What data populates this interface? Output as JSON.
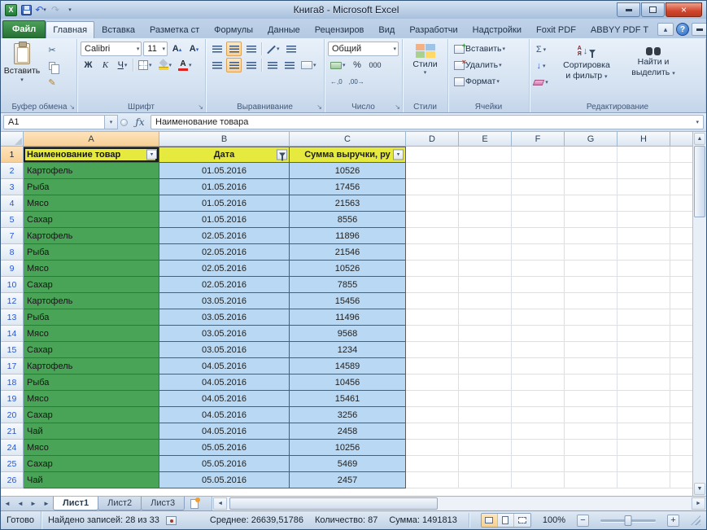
{
  "colors": {
    "header_fill": "#e6e93e",
    "col_a_fill": "#4aa457",
    "data_fill": "#b9d8f3",
    "row_number_filtered": "#2456d6",
    "file_tab_green": "#2f7d3a",
    "selection_highlight": "#f8cf95"
  },
  "title_bar": {
    "title": "Книга8  -  Microsoft Excel"
  },
  "ribbon_tabs": [
    {
      "label": "Файл",
      "file": true
    },
    {
      "label": "Главная",
      "active": true
    },
    {
      "label": "Вставка"
    },
    {
      "label": "Разметка ст"
    },
    {
      "label": "Формулы"
    },
    {
      "label": "Данные"
    },
    {
      "label": "Рецензиров"
    },
    {
      "label": "Вид"
    },
    {
      "label": "Разработчи"
    },
    {
      "label": "Надстройки"
    },
    {
      "label": "Foxit PDF"
    },
    {
      "label": "ABBYY PDF T"
    }
  ],
  "ribbon": {
    "clipboard": {
      "paste_label": "Вставить",
      "group_label": "Буфер обмена"
    },
    "font": {
      "font_name": "Calibri",
      "font_size": "11",
      "bold": "Ж",
      "italic": "К",
      "underline": "Ч",
      "group_label": "Шрифт"
    },
    "alignment": {
      "group_label": "Выравнивание"
    },
    "number": {
      "format": "Общий",
      "percent": "%",
      "thousands": "000",
      "inc_decimal": "←,0",
      "dec_decimal": ",00→",
      "group_label": "Число"
    },
    "styles": {
      "label": "Стили",
      "group_label": "Стили"
    },
    "cells": {
      "insert": "Вставить",
      "delete": "Удалить",
      "format": "Формат",
      "group_label": "Ячейки"
    },
    "editing": {
      "autosum": "Σ",
      "sort_line1": "Сортировка",
      "sort_line2": "и фильтр",
      "find_line1": "Найти и",
      "find_line2": "выделить",
      "group_label": "Редактирование"
    }
  },
  "formula_bar": {
    "name_box": "A1",
    "fx": "ƒx",
    "value": "Наименование товара"
  },
  "grid": {
    "columns": [
      {
        "label": "A",
        "selected": true
      },
      {
        "label": "B"
      },
      {
        "label": "C"
      },
      {
        "label": "D"
      },
      {
        "label": "E"
      },
      {
        "label": "F"
      },
      {
        "label": "G"
      },
      {
        "label": "H"
      }
    ],
    "header_row": {
      "num": "1",
      "a": "Наименование товар",
      "b": "Дата",
      "c": "Сумма выручки, ру"
    },
    "rows": [
      {
        "num": "2",
        "name": "Картофель",
        "date": "01.05.2016",
        "sum": "10526"
      },
      {
        "num": "3",
        "name": "Рыба",
        "date": "01.05.2016",
        "sum": "17456"
      },
      {
        "num": "4",
        "name": "Мясо",
        "date": "01.05.2016",
        "sum": "21563"
      },
      {
        "num": "5",
        "name": "Сахар",
        "date": "01.05.2016",
        "sum": "8556"
      },
      {
        "num": "7",
        "name": "Картофель",
        "date": "02.05.2016",
        "sum": "11896"
      },
      {
        "num": "8",
        "name": "Рыба",
        "date": "02.05.2016",
        "sum": "21546"
      },
      {
        "num": "9",
        "name": "Мясо",
        "date": "02.05.2016",
        "sum": "10526"
      },
      {
        "num": "10",
        "name": "Сахар",
        "date": "02.05.2016",
        "sum": "7855"
      },
      {
        "num": "12",
        "name": "Картофель",
        "date": "03.05.2016",
        "sum": "15456"
      },
      {
        "num": "13",
        "name": "Рыба",
        "date": "03.05.2016",
        "sum": "11496"
      },
      {
        "num": "14",
        "name": "Мясо",
        "date": "03.05.2016",
        "sum": "9568"
      },
      {
        "num": "15",
        "name": "Сахар",
        "date": "03.05.2016",
        "sum": "1234"
      },
      {
        "num": "17",
        "name": "Картофель",
        "date": "04.05.2016",
        "sum": "14589"
      },
      {
        "num": "18",
        "name": "Рыба",
        "date": "04.05.2016",
        "sum": "10456"
      },
      {
        "num": "19",
        "name": "Мясо",
        "date": "04.05.2016",
        "sum": "15461"
      },
      {
        "num": "20",
        "name": "Сахар",
        "date": "04.05.2016",
        "sum": "3256"
      },
      {
        "num": "21",
        "name": "Чай",
        "date": "04.05.2016",
        "sum": "2458"
      },
      {
        "num": "24",
        "name": "Мясо",
        "date": "05.05.2016",
        "sum": "10256"
      },
      {
        "num": "25",
        "name": "Сахар",
        "date": "05.05.2016",
        "sum": "5469"
      },
      {
        "num": "26",
        "name": "Чай",
        "date": "05.05.2016",
        "sum": "2457"
      }
    ]
  },
  "sheet_tabs": [
    {
      "label": "Лист1",
      "active": true
    },
    {
      "label": "Лист2"
    },
    {
      "label": "Лист3"
    }
  ],
  "status_bar": {
    "mode": "Готово",
    "found": "Найдено записей: 28 из 33",
    "average": "Среднее: 26639,51786",
    "count": "Количество: 87",
    "sum": "Сумма: 1491813",
    "zoom": "100%"
  }
}
